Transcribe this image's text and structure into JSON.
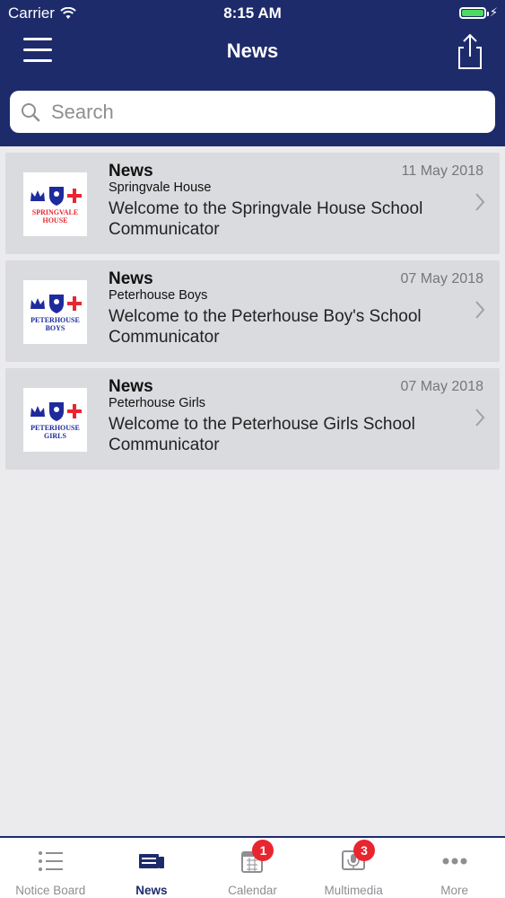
{
  "status_bar": {
    "carrier": "Carrier",
    "time": "8:15 AM"
  },
  "nav": {
    "title": "News"
  },
  "search": {
    "placeholder": "Search"
  },
  "news_items": [
    {
      "kind": "News",
      "source": "Springvale House",
      "date": "11 May 2018",
      "text": "Welcome to the Springvale House  School Communicator",
      "logo_text": [
        "SPRINGVALE",
        "HOUSE"
      ],
      "logo_color": "#e8262f"
    },
    {
      "kind": "News",
      "source": "Peterhouse Boys",
      "date": "07 May 2018",
      "text": "Welcome to the Peterhouse Boy's School Communicator",
      "logo_text": [
        "PETERHOUSE",
        "BOYS"
      ],
      "logo_color": "#1e2b9c"
    },
    {
      "kind": "News",
      "source": "Peterhouse Girls",
      "date": "07 May 2018",
      "text": "Welcome to the Peterhouse Girls School Communicator",
      "logo_text": [
        "PETERHOUSE",
        "GIRLS"
      ],
      "logo_color": "#1e2b9c"
    }
  ],
  "tabs": [
    {
      "label": "Notice Board",
      "icon": "list-icon",
      "active": false
    },
    {
      "label": "News",
      "icon": "newspaper-icon",
      "active": true
    },
    {
      "label": "Calendar",
      "icon": "calendar-icon",
      "active": false,
      "badge": "1"
    },
    {
      "label": "Multimedia",
      "icon": "microphone-icon",
      "active": false,
      "badge": "3"
    },
    {
      "label": "More",
      "icon": "more-dots-icon",
      "active": false
    }
  ],
  "colors": {
    "header": "#1e2b6b",
    "badge": "#e8262f",
    "battery": "#4cd964"
  }
}
